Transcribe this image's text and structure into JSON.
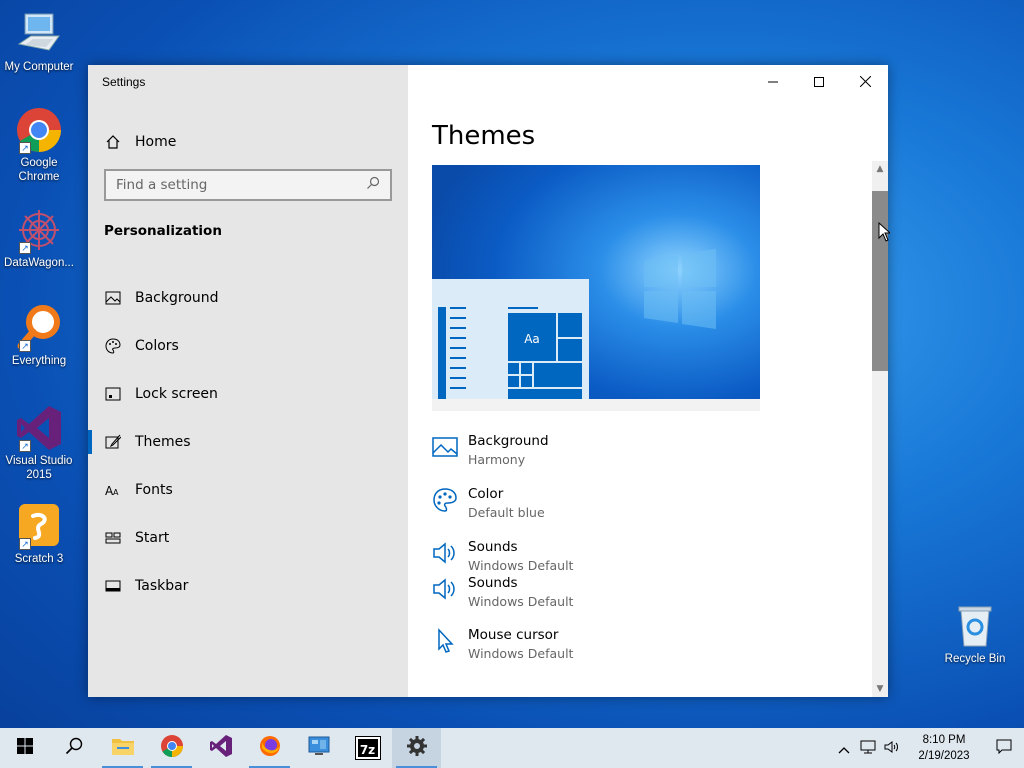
{
  "desktop": {
    "icons": [
      {
        "label": "My Computer",
        "icon": "computer-icon"
      },
      {
        "label": "Google Chrome",
        "icon": "chrome-icon"
      },
      {
        "label": "DataWagon...",
        "icon": "datawagon-icon"
      },
      {
        "label": "Everything",
        "icon": "search-magnifier-icon"
      },
      {
        "label": "Visual Studio 2015",
        "icon": "visual-studio-icon"
      },
      {
        "label": "Scratch 3",
        "icon": "scratch-icon"
      },
      {
        "label": "Recycle Bin",
        "icon": "recycle-bin-icon"
      }
    ]
  },
  "window": {
    "title": "Settings",
    "home_label": "Home",
    "search": {
      "placeholder": "Find a setting"
    },
    "section": "Personalization",
    "nav": [
      {
        "label": "Background",
        "icon": "picture-icon"
      },
      {
        "label": "Colors",
        "icon": "palette-icon"
      },
      {
        "label": "Lock screen",
        "icon": "lock-screen-icon"
      },
      {
        "label": "Themes",
        "icon": "brush-icon",
        "active": true
      },
      {
        "label": "Fonts",
        "icon": "fonts-icon"
      },
      {
        "label": "Start",
        "icon": "start-icon"
      },
      {
        "label": "Taskbar",
        "icon": "taskbar-icon"
      }
    ]
  },
  "content": {
    "title": "Themes",
    "preview_tile_label": "Aa",
    "items": [
      {
        "name": "Background",
        "value": "Harmony",
        "icon": "picture-icon"
      },
      {
        "name": "Color",
        "value": "Default blue",
        "icon": "palette-icon"
      },
      {
        "name": "Sounds",
        "value": "Windows Default",
        "icon": "speaker-icon"
      },
      {
        "name": "Sounds",
        "value": "Windows Default",
        "icon": "speaker-icon"
      },
      {
        "name": "Mouse cursor",
        "value": "Windows Default",
        "icon": "cursor-icon"
      }
    ]
  },
  "taskbar": {
    "apps": [
      "start-icon",
      "search-icon",
      "file-explorer-icon",
      "chrome-icon",
      "visual-studio-icon",
      "firefox-icon",
      "control-panel-icon",
      "7zip-icon",
      "settings-gear-icon"
    ],
    "clock_time": "8:10 PM",
    "clock_date": "2/19/2023",
    "sevenzip_label": "7z"
  },
  "colors": {
    "accent": "#0067c0",
    "sidebar": "#e6e6e6",
    "taskbar": "#dfe7ef"
  }
}
